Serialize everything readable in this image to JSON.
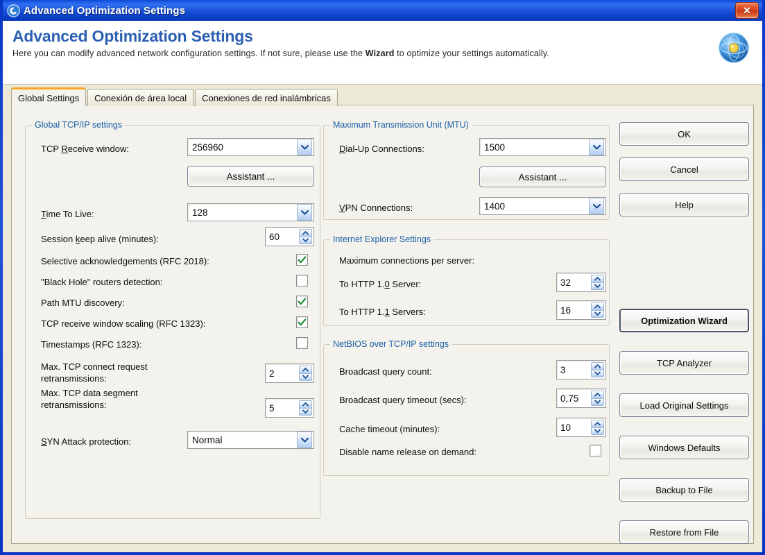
{
  "window": {
    "title": "Advanced Optimization Settings",
    "app_icon": "app-swirl-icon",
    "close_label": "✕"
  },
  "banner": {
    "title": "Advanced Optimization Settings",
    "desc_before": "Here you can modify advanced network configuration settings. If not sure, please use the ",
    "desc_bold": "Wizard",
    "desc_after": " to optimize your settings automatically.",
    "logo_icon": "network-globe-icon"
  },
  "tabs": [
    {
      "label": "Global Settings",
      "active": true
    },
    {
      "label": "Conexión de área local",
      "active": false
    },
    {
      "label": "Conexiones de red inalámbricas",
      "active": false
    }
  ],
  "groups": {
    "global_tcpip": {
      "title": "Global TCP/IP settings",
      "tcp_receive_window": {
        "label_a": "TCP ",
        "label_u": "R",
        "label_b": "eceive window:",
        "value": "256960"
      },
      "assistant_button": "Assistant ...",
      "time_to_live": {
        "label_u": "T",
        "label_b": "ime To Live:",
        "value": "128"
      },
      "session_keep_alive": {
        "label_a": "Session ",
        "label_u": "k",
        "label_b": "eep alive (minutes):",
        "value": "60"
      },
      "checkboxes": [
        {
          "label": "Selective acknowledgements (RFC 2018):",
          "checked": true
        },
        {
          "label": "\"Black Hole\" routers detection:",
          "checked": false
        },
        {
          "label": "Path MTU discovery:",
          "checked": true
        },
        {
          "label": "TCP receive window scaling (RFC 1323):",
          "checked": true
        },
        {
          "label": "Timestamps (RFC 1323):",
          "checked": false
        }
      ],
      "max_connect_retrans": {
        "line1": "Max. TCP connect request",
        "line2": "retransmissions:",
        "value": "2"
      },
      "max_data_retrans": {
        "line1": "Max. TCP data segment",
        "line2": "retransmissions:",
        "value": "5"
      },
      "syn_attack": {
        "label_u": "S",
        "label_b": "YN Attack protection:",
        "value": "Normal"
      }
    },
    "mtu": {
      "title": "Maximum Transmission Unit (MTU)",
      "dialup": {
        "label_u": "D",
        "label_b": "ial-Up Connections:",
        "value": "1500"
      },
      "assistant_button": "Assistant ...",
      "vpn": {
        "label_u": "V",
        "label_b": "PN Connections:",
        "value": "1400"
      }
    },
    "ie": {
      "title": "Internet Explorer Settings",
      "max_conn_label": "Maximum connections per server:",
      "http10": {
        "label_a": "To HTTP 1.",
        "label_u": "0",
        "label_b": " Server:",
        "value": "32"
      },
      "http11": {
        "label_a": "To HTTP 1.",
        "label_u": "1",
        "label_b": " Servers:",
        "value": "16"
      }
    },
    "netbios": {
      "title": "NetBIOS over TCP/IP settings",
      "broadcast_count": {
        "label": "Broadcast query count:",
        "value": "3"
      },
      "broadcast_timeout": {
        "label": "Broadcast query timeout (secs):",
        "value": "0,75"
      },
      "cache_timeout": {
        "label": "Cache timeout (minutes):",
        "value": "10"
      },
      "disable_name_release": {
        "label": "Disable name release on demand:",
        "checked": false
      }
    }
  },
  "side_buttons": [
    {
      "label": "OK",
      "bold": false
    },
    {
      "label": "Cancel",
      "bold": false
    },
    {
      "label": "Help",
      "bold": false
    },
    {
      "label": "Optimization Wizard",
      "bold": true
    },
    {
      "label": "TCP Analyzer",
      "bold": false
    },
    {
      "label": "Load Original Settings",
      "bold": false
    },
    {
      "label": "Windows Defaults",
      "bold": false
    },
    {
      "label": "Backup to File",
      "bold": false
    },
    {
      "label": "Restore from File",
      "bold": false
    }
  ],
  "colors": {
    "titlebar_blue": "#1a52da",
    "banner_title_blue": "#2b5fb2",
    "group_title_blue": "#1c5fa8",
    "client_beige": "#ece9d8",
    "panel_beige": "#f3f2ec",
    "active_tab_accent": "#f5a623",
    "check_green": "#1f8b2e",
    "close_red": "#cc3b14"
  }
}
